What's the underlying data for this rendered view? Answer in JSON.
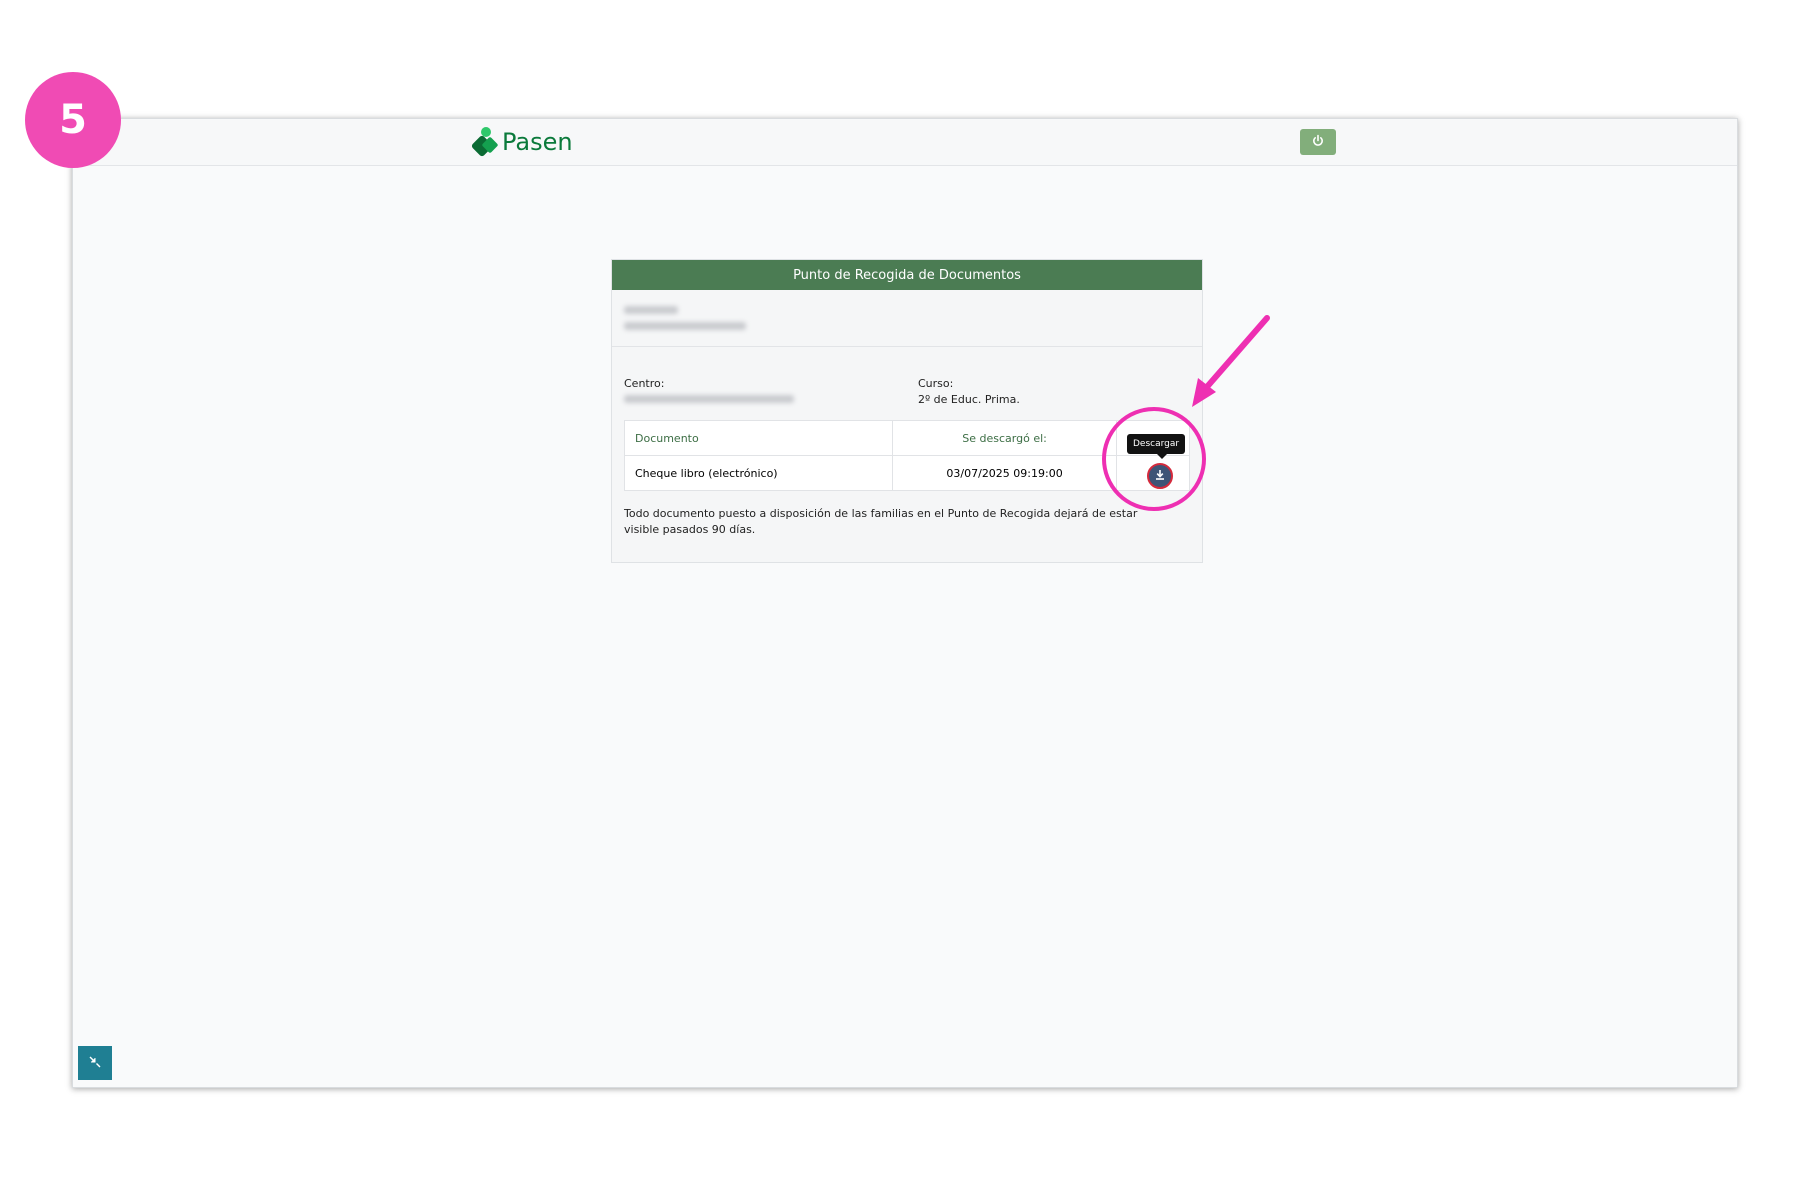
{
  "step": {
    "number": "5",
    "color": "#f04bb4"
  },
  "brand": {
    "name": "Pasen",
    "color": "#0b7a3b"
  },
  "topbar": {
    "power_icon": "power-icon",
    "power_color": "#82ae7b"
  },
  "panel": {
    "title": "Punto de Recogida de Documentos",
    "header_color": "#4b7c53",
    "centro_label": "Centro:",
    "curso_label": "Curso:",
    "curso_value": "2º de Educ. Prima."
  },
  "table": {
    "headers": [
      "Documento",
      "Se descargó el:"
    ],
    "rows": [
      {
        "documento": "Cheque libro (electrónico)",
        "fecha": "03/07/2025 09:19:00"
      }
    ]
  },
  "download": {
    "tooltip": "Descargar",
    "icon": "download-icon",
    "color": "#3e5476"
  },
  "footnote": "Todo documento puesto a disposición de las familias en el Punto de Recogida dejará de estar visible pasados 90 días.",
  "fullscreen": {
    "icon": "collapse-icon",
    "color": "#1f7f93"
  },
  "annotation": {
    "color": "#ee2fb2",
    "icons": [
      "highlight-circle",
      "pointer-arrow"
    ]
  }
}
